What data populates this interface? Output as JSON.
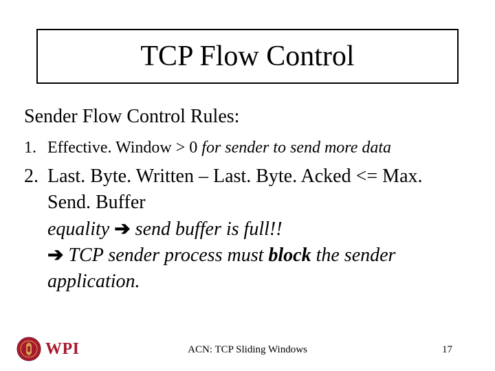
{
  "title": "TCP Flow Control",
  "subtitle": "Sender Flow Control Rules:",
  "rule1": {
    "num": "1.",
    "cond": "Effective. Window > 0",
    "rest": "  for sender to send more data"
  },
  "rule2": {
    "num": "2.",
    "line1": "Last. Byte. Written – Last. Byte. Acked <= Max. Send. Buffer",
    "equality": "equality ",
    "arrow1": "➔",
    "full": " send buffer is full!!",
    "arrow2": "➔",
    "proc1": " TCP sender process must ",
    "block": "block",
    "proc2": " the sender application."
  },
  "footer": {
    "center": "ACN: TCP Sliding Windows",
    "pageNum": "17"
  },
  "logo": {
    "text": "WPI"
  }
}
